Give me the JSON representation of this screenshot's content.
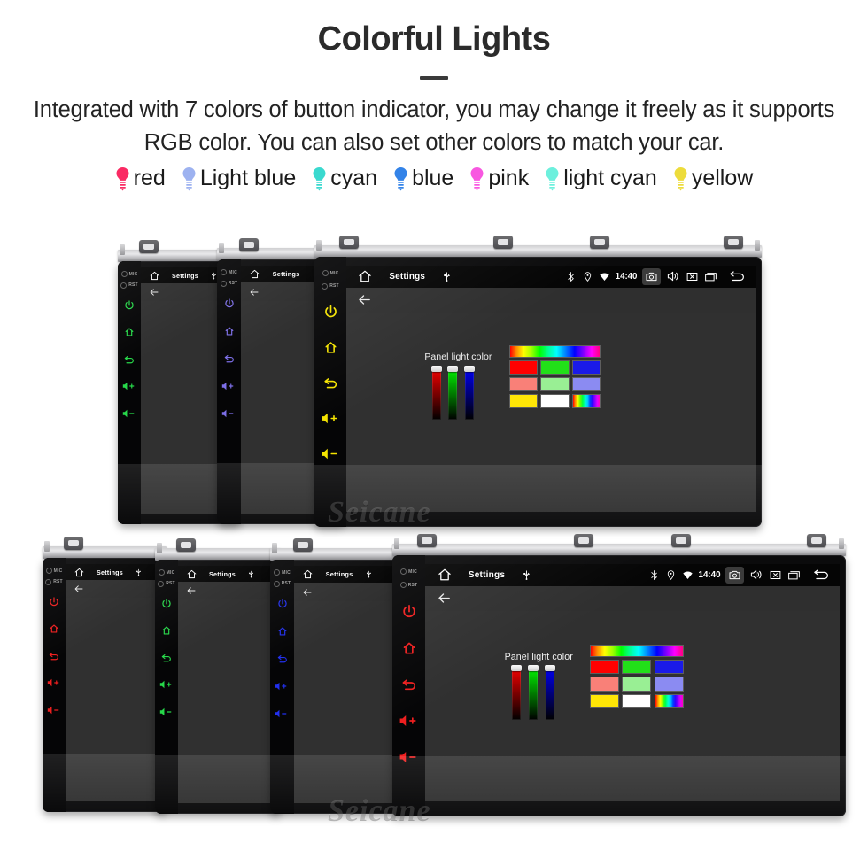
{
  "header": {
    "title": "Colorful Lights",
    "subtitle": "Integrated with 7 colors of button indicator, you may change it freely as it supports RGB color. You can also set other colors to match your car."
  },
  "legend": [
    {
      "label": "red",
      "color": "#fa2a63"
    },
    {
      "label": "Light blue",
      "color": "#9db2f0"
    },
    {
      "label": "cyan",
      "color": "#3ad9cf"
    },
    {
      "label": "blue",
      "color": "#3383e8"
    },
    {
      "label": "pink",
      "color": "#f857e0"
    },
    {
      "label": "light cyan",
      "color": "#6df0dd"
    },
    {
      "label": "yellow",
      "color": "#eddc3b"
    }
  ],
  "device_ui": {
    "status_bar": {
      "title": "Settings",
      "clock": "14:40",
      "icons": [
        "home-icon",
        "usb-icon",
        "bluetooth-icon",
        "location-icon",
        "wifi-icon",
        "camera-icon",
        "volume-icon",
        "close-icon",
        "recents-icon",
        "back-icon"
      ]
    },
    "action_bar": {
      "back_label": "back-arrow-icon"
    },
    "panel": {
      "label": "Panel light color",
      "sliders": [
        {
          "name": "red-slider",
          "color": "#ff0000",
          "value": 100
        },
        {
          "name": "green-slider",
          "color": "#00ff00",
          "value": 100
        },
        {
          "name": "blue-slider",
          "color": "#0000ff",
          "value": 100
        }
      ],
      "swatches": [
        {
          "name": "rainbow-gradient-swatch",
          "color": "rainbow-h"
        },
        {
          "name": "red-swatch",
          "color": "#ff0000"
        },
        {
          "name": "green-swatch",
          "color": "#22e019"
        },
        {
          "name": "blue-swatch",
          "color": "#1a1ae8"
        },
        {
          "name": "salmon-swatch",
          "color": "#f98078"
        },
        {
          "name": "light-green-swatch",
          "color": "#99ef94"
        },
        {
          "name": "periwinkle-swatch",
          "color": "#8b8bf2"
        },
        {
          "name": "yellow-swatch",
          "color": "#ffe606"
        },
        {
          "name": "white-swatch",
          "color": "#ffffff"
        },
        {
          "name": "rainbow-strip-swatch",
          "color": "rainbow-v"
        }
      ]
    },
    "side_buttons": {
      "mic_label": "MIC",
      "rst_label": "RST",
      "icons": [
        "power-icon",
        "home-icon",
        "back-icon",
        "volume-up-icon",
        "volume-down-icon"
      ]
    }
  },
  "devices": {
    "top_row": [
      {
        "name": "device-green",
        "button_color": "#27d94a",
        "detailed": false
      },
      {
        "name": "device-purple",
        "button_color": "#7d6fe8",
        "detailed": false
      },
      {
        "name": "device-yellow",
        "button_color": "#f5e400",
        "detailed": true
      }
    ],
    "bottom_row": [
      {
        "name": "device-red",
        "button_color": "#ee1f1f",
        "detailed": false
      },
      {
        "name": "device-green-2",
        "button_color": "#27d94a",
        "detailed": false
      },
      {
        "name": "device-blue",
        "button_color": "#2230ee",
        "detailed": false
      },
      {
        "name": "device-red-large",
        "button_color": "#ee1f1f",
        "detailed": true
      }
    ]
  },
  "watermark": {
    "text": "Seicane"
  }
}
